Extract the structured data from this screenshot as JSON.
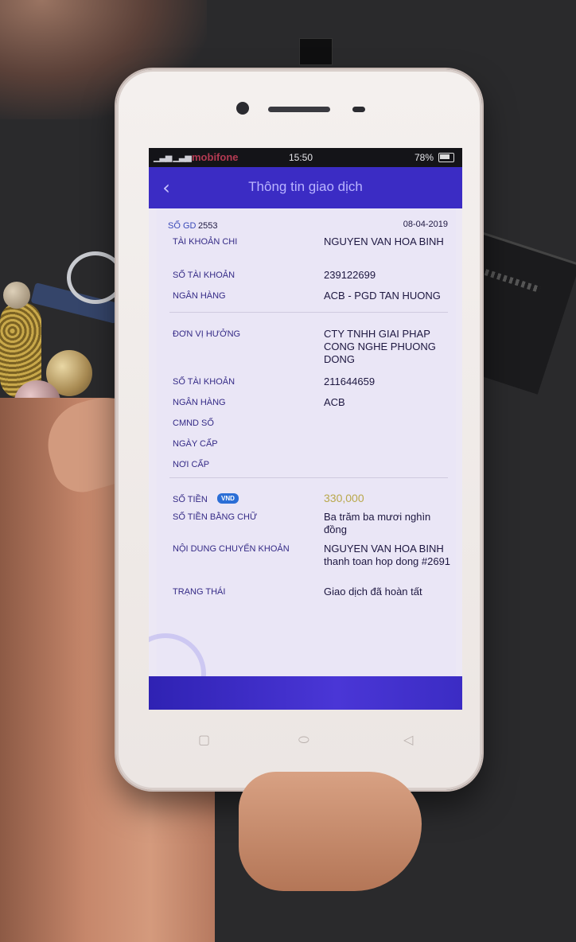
{
  "status_bar": {
    "carrier": "mobifone",
    "time": "15:50",
    "battery": "78%"
  },
  "app_bar": {
    "title": "Thông tin giao dịch",
    "back_icon": "chevron-left-icon"
  },
  "transaction": {
    "id_label": "SỐ GD",
    "id_value": "2553",
    "date": "08-04-2019",
    "sender": {
      "account_holder_label": "TÀI KHOẢN CHI",
      "account_holder_value": "NGUYEN VAN HOA BINH",
      "account_number_label": "SỐ TÀI KHOẢN",
      "account_number_value": "239122699",
      "bank_label": "NGÂN HÀNG",
      "bank_value": "ACB - PGD TAN HUONG"
    },
    "receiver": {
      "beneficiary_label": "ĐƠN VỊ HƯỞNG",
      "beneficiary_value": "CTY TNHH GIAI PHAP CONG NGHE PHUONG DONG",
      "account_number_label": "SỐ TÀI KHOẢN",
      "account_number_value": "211644659",
      "bank_label": "NGÂN HÀNG",
      "bank_value": "ACB",
      "id_card_label": "CMND SỐ",
      "issue_date_label": "NGÀY CẤP",
      "issue_place_label": "NƠI CẤP"
    },
    "details": {
      "amount_label": "SỐ TIỀN",
      "currency_badge": "VND",
      "amount_value": "330,000",
      "amount_words_label": "SỐ TIỀN BẰNG CHỮ",
      "amount_words_value": "Ba trăm ba mươi nghìn đồng",
      "content_label": "NỘI DUNG CHUYỂN KHOẢN",
      "content_value": "NGUYEN VAN HOA BINH thanh toan hop dong #2691",
      "status_label": "TRẠNG THÁI",
      "status_value": "Giao dịch đã hoàn tất"
    }
  },
  "colors": {
    "app_bar": "#3b2cc4",
    "label": "#342a86",
    "amount": "#b9a84c",
    "badge": "#2b6ed6"
  }
}
